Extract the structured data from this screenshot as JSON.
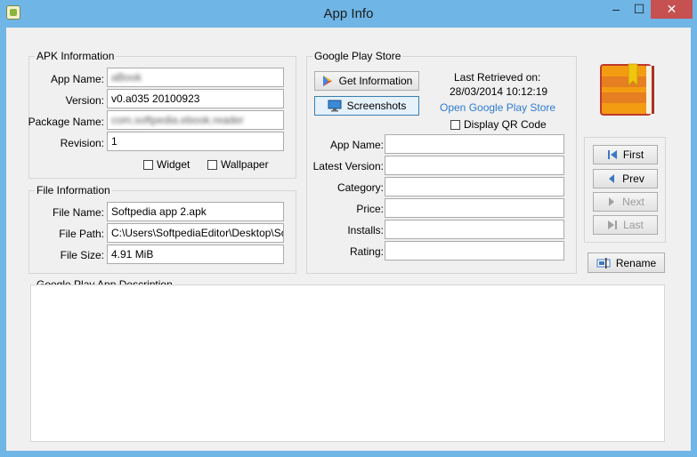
{
  "window": {
    "title": "App Info",
    "min": "–",
    "max": "☐",
    "close": "✕"
  },
  "apk": {
    "title": "APK Information",
    "app_name_label": "App Name:",
    "app_name_value": "aBook",
    "version_label": "Version:",
    "version_value": "v0.a035 20100923",
    "package_label": "Package Name:",
    "package_value": "com.softpedia.ebook.reader",
    "revision_label": "Revision:",
    "revision_value": "1",
    "widget_label": "Widget",
    "wallpaper_label": "Wallpaper"
  },
  "file": {
    "title": "File Information",
    "name_label": "File Name:",
    "name_value": "Softpedia app 2.apk",
    "path_label": "File Path:",
    "path_value": "C:\\Users\\SoftpediaEditor\\Desktop\\Softpedia",
    "size_label": "File Size:",
    "size_value": "4.91 MiB"
  },
  "gplay": {
    "title": "Google Play Store",
    "get_info_label": "Get Information",
    "screenshots_label": "Screenshots",
    "last_retrieved_label": "Last Retrieved on:",
    "last_retrieved_value": "28/03/2014 10:12:19",
    "open_store_label": "Open Google Play Store",
    "qr_label": "Display QR Code",
    "app_name_label": "App Name:",
    "latest_version_label": "Latest Version:",
    "category_label": "Category:",
    "price_label": "Price:",
    "installs_label": "Installs:",
    "rating_label": "Rating:"
  },
  "nav": {
    "first": "First",
    "prev": "Prev",
    "next": "Next",
    "last": "Last"
  },
  "rename_label": "Rename",
  "description": {
    "title": "Google Play App Description"
  }
}
